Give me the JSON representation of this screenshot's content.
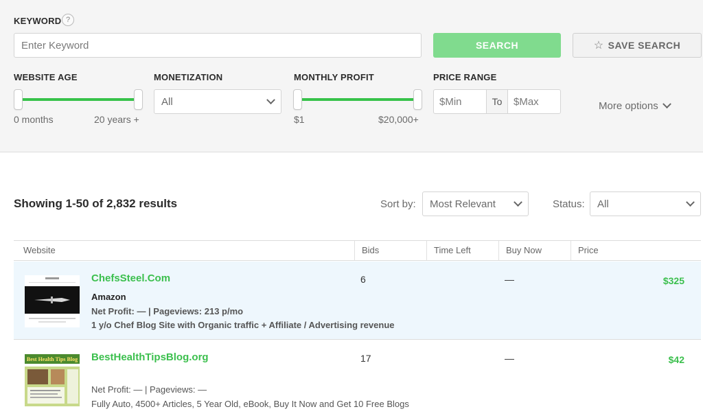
{
  "filters": {
    "keyword_label": "KEYWORD",
    "help_glyph": "?",
    "keyword_placeholder": "Enter Keyword",
    "search_label": "SEARCH",
    "save_search_label": "SAVE SEARCH",
    "website_age": {
      "label": "WEBSITE AGE",
      "min_label": "0 months",
      "max_label": "20 years +",
      "selected_range_fraction": [
        0,
        1
      ]
    },
    "monetization": {
      "label": "MONETIZATION",
      "selected": "All"
    },
    "monthly_profit": {
      "label": "MONTHLY PROFIT",
      "min_label": "$1",
      "max_label": "$20,000+",
      "selected_range_fraction": [
        0,
        1
      ]
    },
    "price_range": {
      "label": "PRICE RANGE",
      "min_placeholder": "$Min",
      "to_label": "To",
      "max_placeholder": "$Max"
    },
    "more_options_label": "More options"
  },
  "results": {
    "summary": "Showing 1-50 of 2,832 results",
    "sort_label": "Sort by:",
    "sort_selected": "Most Relevant",
    "status_label": "Status:",
    "status_selected": "All"
  },
  "table": {
    "columns": [
      "Website",
      "Bids",
      "Time Left",
      "Buy Now",
      "Price"
    ],
    "rows": [
      {
        "name": "ChefsSteel.Com",
        "category": "Amazon",
        "stats": "Net Profit: — | Pageviews: 213 p/mo",
        "description": "1 y/o Chef Blog Site with Organic traffic + Affiliate / Advertising revenue",
        "bids": "6",
        "buy_now": "—",
        "price": "$325"
      },
      {
        "name": "BestHealthTipsBlog.org",
        "category": "",
        "stats": "Net Profit: — | Pageviews: —",
        "description": "Fully Auto, 4500+ Articles, 5 Year Old, eBook, Buy It Now and Get 10 Free Blogs",
        "bids": "17",
        "buy_now": "—",
        "price": "$42",
        "thumb_title": "Best Health Tips Blog"
      }
    ]
  },
  "colors": {
    "accent_green": "#3bbf4d",
    "search_button": "#80db8e",
    "highlight_row": "#eef7fd"
  }
}
